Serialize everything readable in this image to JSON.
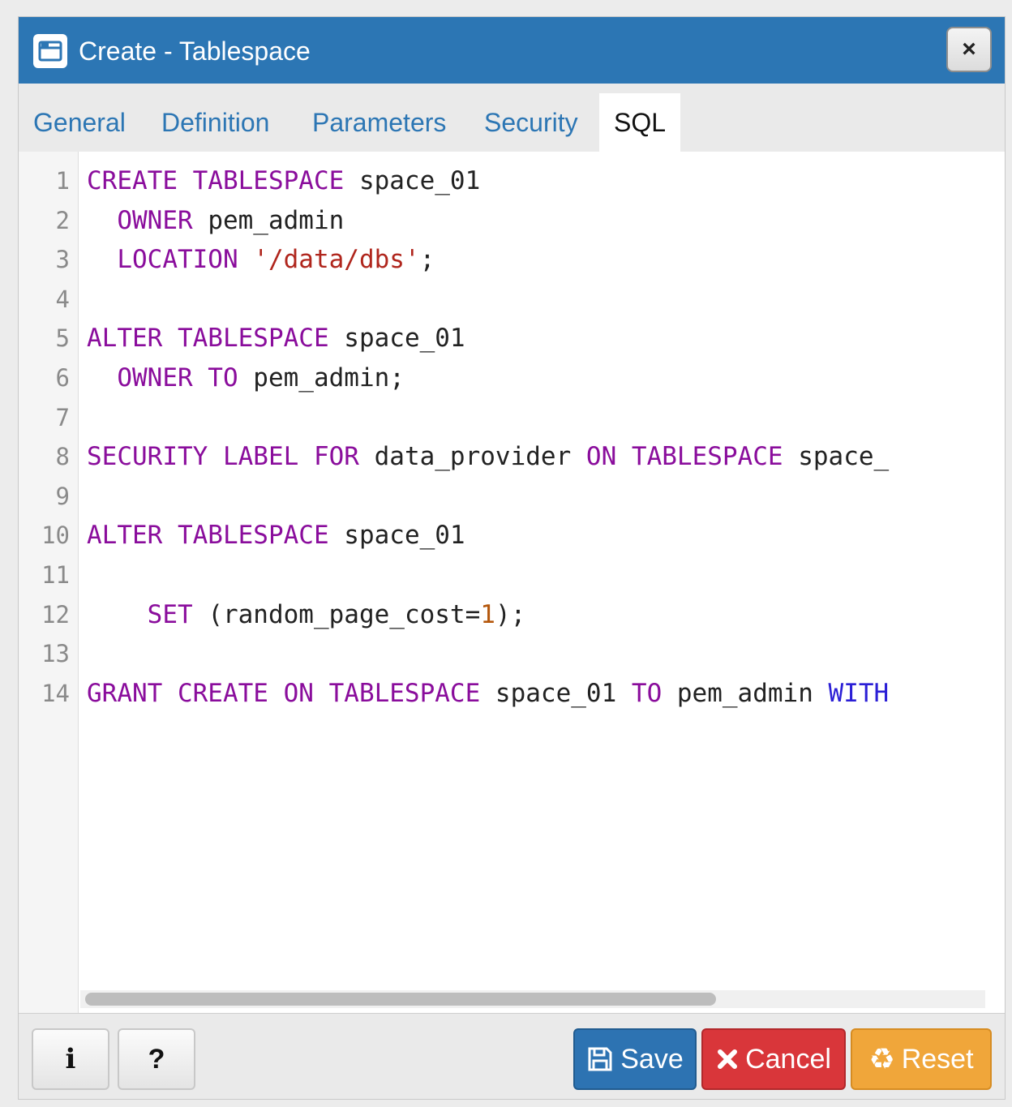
{
  "dialog": {
    "title": "Create - Tablespace",
    "close_label": "×",
    "icon": "folder-icon"
  },
  "tabs": [
    {
      "label": "General",
      "active": false
    },
    {
      "label": "Definition",
      "active": false
    },
    {
      "label": "Parameters",
      "active": false
    },
    {
      "label": "Security",
      "active": false
    },
    {
      "label": "SQL",
      "active": true
    }
  ],
  "editor": {
    "line_numbers": [
      "1",
      "2",
      "3",
      "4",
      "5",
      "6",
      "7",
      "8",
      "9",
      "10",
      "11",
      "12",
      "13",
      "14"
    ],
    "lines": [
      [
        {
          "t": "CREATE TABLESPACE",
          "c": "keyword"
        },
        {
          "t": " space_01",
          "c": "plain"
        }
      ],
      [
        {
          "t": "  ",
          "c": "plain"
        },
        {
          "t": "OWNER",
          "c": "keyword"
        },
        {
          "t": " pem_admin",
          "c": "plain"
        }
      ],
      [
        {
          "t": "  ",
          "c": "plain"
        },
        {
          "t": "LOCATION",
          "c": "keyword"
        },
        {
          "t": " ",
          "c": "plain"
        },
        {
          "t": "'/data/dbs'",
          "c": "string"
        },
        {
          "t": ";",
          "c": "plain"
        }
      ],
      [],
      [
        {
          "t": "ALTER TABLESPACE",
          "c": "keyword"
        },
        {
          "t": " space_01",
          "c": "plain"
        }
      ],
      [
        {
          "t": "  ",
          "c": "plain"
        },
        {
          "t": "OWNER TO",
          "c": "keyword"
        },
        {
          "t": " pem_admin;",
          "c": "plain"
        }
      ],
      [],
      [
        {
          "t": "SECURITY LABEL FOR",
          "c": "keyword"
        },
        {
          "t": " data_provider ",
          "c": "plain"
        },
        {
          "t": "ON TABLESPACE",
          "c": "keyword"
        },
        {
          "t": " space_",
          "c": "plain"
        }
      ],
      [],
      [
        {
          "t": "ALTER TABLESPACE",
          "c": "keyword"
        },
        {
          "t": " space_01",
          "c": "plain"
        }
      ],
      [],
      [
        {
          "t": "    ",
          "c": "plain"
        },
        {
          "t": "SET",
          "c": "keyword"
        },
        {
          "t": " (random_page_cost=",
          "c": "plain"
        },
        {
          "t": "1",
          "c": "number"
        },
        {
          "t": ");",
          "c": "plain"
        }
      ],
      [],
      [
        {
          "t": "GRANT CREATE ON TABLESPACE",
          "c": "keyword"
        },
        {
          "t": " space_01 ",
          "c": "plain"
        },
        {
          "t": "TO",
          "c": "keyword"
        },
        {
          "t": " pem_admin ",
          "c": "plain"
        },
        {
          "t": "WITH",
          "c": "builtin"
        }
      ]
    ]
  },
  "footer": {
    "info_label": "i",
    "help_label": "?",
    "save_label": "Save",
    "cancel_label": "Cancel",
    "reset_label": "Reset"
  },
  "colors": {
    "titlebar": "#2c76b4",
    "tab_link": "#2c76b4",
    "keyword": "#8a0d9c",
    "string": "#b0261d",
    "number": "#b4570c",
    "builtin": "#2b1fd6",
    "save": "#2d73b2",
    "cancel": "#d9363a",
    "reset": "#f0a63a"
  }
}
